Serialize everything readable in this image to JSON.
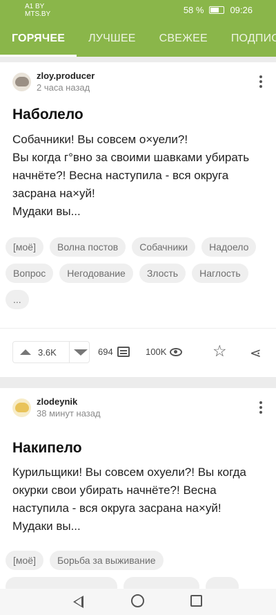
{
  "status_bar": {
    "carrier1": "A1 BY",
    "carrier2": "MTS.BY",
    "battery": "58 %",
    "time": "09:26"
  },
  "tabs": [
    {
      "label": "ГОРЯЧЕЕ",
      "active": true
    },
    {
      "label": "ЛУЧШЕЕ",
      "active": false
    },
    {
      "label": "СВЕЖЕЕ",
      "active": false
    },
    {
      "label": "ПОДПИСК",
      "active": false
    }
  ],
  "posts": [
    {
      "author": "zloy.producer",
      "time": "2 часа назад",
      "title": "Наболело",
      "text": [
        "Собачники! Вы совсем о×уели?!",
        "Вы когда г°вно за своими шавками убирать начнёте?! Весна наступила - вся округа засрана на×уй!",
        "Мудаки вы..."
      ],
      "tags": [
        "[моё]",
        "Волна постов",
        "Собачники",
        "Надоело",
        "Вопрос",
        "Негодование",
        "Злость",
        "Наглость",
        "..."
      ],
      "rating": "3.6K",
      "comments": "694",
      "views": "100K"
    },
    {
      "author": "zlodeynik",
      "time": "38 минут назад",
      "title": "Накипело",
      "text": [
        "Курильщики! Вы совсем охуели?! Вы когда окурки свои убирать начнёте?! Весна наступила - вся округа засрана на×уй!",
        "Мудаки вы..."
      ],
      "tags": [
        "[моё]",
        "Борьба за выживание"
      ]
    }
  ],
  "icons": {
    "more": "more-vertical-icon",
    "upvote": "arrow-up-icon",
    "downvote": "arrow-down-icon",
    "comments": "comment-icon",
    "views": "eye-icon",
    "save": "star-icon",
    "share": "share-icon"
  },
  "colors": {
    "header": "#8ab64a"
  }
}
